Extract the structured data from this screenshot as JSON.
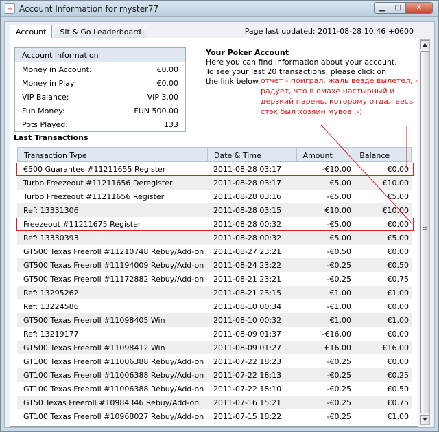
{
  "window": {
    "title": "Account Information for myster77",
    "app_icon": "java-cup-icon",
    "buttons": {
      "minimize": "▁",
      "maximize": "□",
      "close": "✕"
    }
  },
  "tabs": [
    {
      "label": "Account",
      "active": true
    },
    {
      "label": "Sit & Go Leaderboard",
      "active": false
    }
  ],
  "page_updated": "Page last updated: 2011-08-28 10:46 +0600",
  "account": {
    "header": "Account Information",
    "rows": [
      {
        "label": "Money in Account:",
        "value": "€0.00"
      },
      {
        "label": "Money in Play:",
        "value": "€0.00"
      },
      {
        "label": "VIP Balance:",
        "value": "VIP 3.00"
      },
      {
        "label": "Fun Money:",
        "value": "FUN 500.00"
      },
      {
        "label": "Pots Played:",
        "value": "133"
      }
    ]
  },
  "poker_info": {
    "title": "Your Poker Account",
    "line1": "Here you can find information about your account.",
    "line2": "To see your last 20 transactions, please click on",
    "line3": "the link below."
  },
  "annotation": "отчёт - поиграл, жаль везде вылетел, - радует, что в омахе настырный и дерзкий парень, которому отдал весь стэк был хозяин мувов :-)",
  "transactions": {
    "title": "Last Transactions",
    "headers": [
      "Transaction Type",
      "Date & Time",
      "Amount",
      "Balance"
    ],
    "rows": [
      {
        "type": "€500 Guarantee #11211655 Register",
        "date": "2011-08-28 03:17",
        "amount": "-€10.00",
        "balance": "€0.00"
      },
      {
        "type": "Turbo Freezeout #11211656 Deregister",
        "date": "2011-08-28 03:17",
        "amount": "€5.00",
        "balance": "€10.00"
      },
      {
        "type": "Turbo Freezeout #11211656 Register",
        "date": "2011-08-28 03:16",
        "amount": "-€5.00",
        "balance": "€5.00"
      },
      {
        "type": "Ref: 13331306",
        "date": "2011-08-28 03:15",
        "amount": "€10.00",
        "balance": "€10.00"
      },
      {
        "type": "Freezeout #11211675 Register",
        "date": "2011-08-28 00:32",
        "amount": "-€5.00",
        "balance": "€0.00"
      },
      {
        "type": "Ref: 13330393",
        "date": "2011-08-28 00:32",
        "amount": "€5.00",
        "balance": "€5.00"
      },
      {
        "type": "GT500 Texas Freeroll #11210748 Rebuy/Add-on",
        "date": "2011-08-27 23:21",
        "amount": "-€0.50",
        "balance": "€0.00"
      },
      {
        "type": "GT500 Texas Freeroll #11194009 Rebuy/Add-on",
        "date": "2011-08-24 23:22",
        "amount": "-€0.25",
        "balance": "€0.50"
      },
      {
        "type": "GT500 Texas Freeroll #11172882 Rebuy/Add-on",
        "date": "2011-08-21 23:21",
        "amount": "-€0.25",
        "balance": "€0.75"
      },
      {
        "type": "Ref: 13295262",
        "date": "2011-08-21 23:15",
        "amount": "€1.00",
        "balance": "€1.00"
      },
      {
        "type": "Ref: 13224586",
        "date": "2011-08-10 00:34",
        "amount": "-€1.00",
        "balance": "€0.00"
      },
      {
        "type": "GT500 Texas Freeroll #11098405 Win",
        "date": "2011-08-10 00:32",
        "amount": "€1.00",
        "balance": "€1.00"
      },
      {
        "type": "Ref: 13219177",
        "date": "2011-08-09 01:37",
        "amount": "-€16.00",
        "balance": "€0.00"
      },
      {
        "type": "GT500 Texas Freeroll #11098412 Win",
        "date": "2011-08-09 01:27",
        "amount": "€16.00",
        "balance": "€16.00"
      },
      {
        "type": "GT100 Texas Freeroll #11006388 Rebuy/Add-on",
        "date": "2011-07-22 18:23",
        "amount": "-€0.25",
        "balance": "€0.00"
      },
      {
        "type": "GT100 Texas Freeroll #11006388 Rebuy/Add-on",
        "date": "2011-07-22 18:13",
        "amount": "-€0.25",
        "balance": "€0.25"
      },
      {
        "type": "GT100 Texas Freeroll #11006388 Rebuy/Add-on",
        "date": "2011-07-22 18:10",
        "amount": "-€0.25",
        "balance": "€0.50"
      },
      {
        "type": "GT50 Texas Freeroll #10984346 Rebuy/Add-on",
        "date": "2011-07-16 15:21",
        "amount": "-€0.25",
        "balance": "€0.75"
      },
      {
        "type": "GT100 Texas Freeroll #10968027 Rebuy/Add-on",
        "date": "2011-07-15 18:22",
        "amount": "-€0.25",
        "balance": "€1.00"
      }
    ]
  },
  "colors": {
    "annotation": "#d81f1f",
    "header_bg": "#dfe8f1",
    "alt_row": "#eeeeee"
  },
  "icons": {
    "scroll_up": "▲",
    "scroll_down": "▼"
  }
}
